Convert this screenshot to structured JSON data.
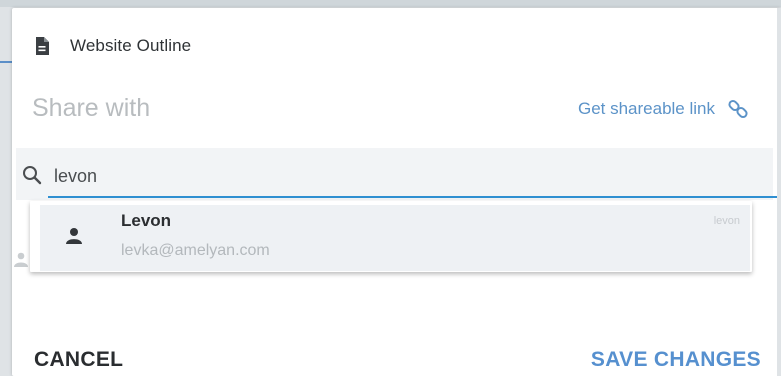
{
  "document": {
    "title": "Website Outline",
    "icon": "document-icon"
  },
  "share": {
    "heading": "Share with",
    "shareable_link_label": "Get shareable link",
    "link_icon": "link-icon"
  },
  "search": {
    "value": "levon",
    "placeholder": "",
    "icon": "search-icon"
  },
  "suggestions": [
    {
      "name": "Levon",
      "email": "levka@amelyan.com",
      "handle": "levon",
      "icon": "person-icon"
    }
  ],
  "actions": {
    "cancel_label": "CANCEL",
    "save_label": "SAVE CHANGES"
  },
  "colors": {
    "accent": "#5690cf",
    "search_underline": "#2f8fd1",
    "muted_text": "#b8bcbf"
  }
}
